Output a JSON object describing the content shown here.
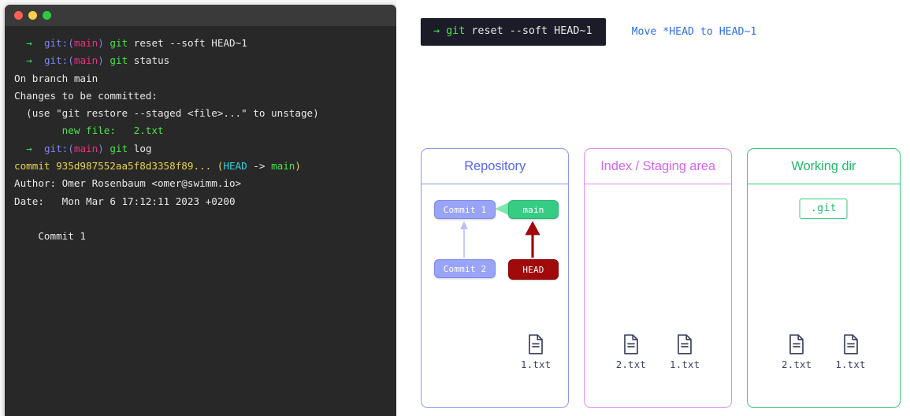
{
  "terminal": {
    "window_dots": [
      "close-red",
      "minimize-yellow",
      "maximize-green"
    ],
    "prompt_arrow": "→",
    "lines": [
      {
        "type": "prompt",
        "arrow": "→",
        "git": "git:",
        "lparen": "(",
        "branch": "main",
        "rparen": ")",
        "cmd": "git",
        "args": " reset --soft HEAD~1"
      },
      {
        "type": "prompt",
        "arrow": "→",
        "git": "git:",
        "lparen": "(",
        "branch": "main",
        "rparen": ")",
        "cmd": "git",
        "args": " status"
      },
      {
        "type": "plain",
        "text": "On branch main"
      },
      {
        "type": "plain",
        "text": "Changes to be committed:"
      },
      {
        "type": "plain",
        "text": "  (use \"git restore --staged <file>...\" to unstage)"
      },
      {
        "type": "green",
        "text": "        new file:   2.txt"
      },
      {
        "type": "prompt",
        "arrow": "→",
        "git": "git:",
        "lparen": "(",
        "branch": "main",
        "rparen": ")",
        "cmd": "git",
        "args": " log"
      },
      {
        "type": "commit",
        "label": "commit ",
        "hash": "935d987552aa5f8d3358f89... ",
        "lparen": "(",
        "head": "HEAD",
        "sep": " -> ",
        "branch": "main",
        "rparen": ")"
      },
      {
        "type": "plain",
        "text": "Author: Omer Rosenbaum <omer@swimm.io>"
      },
      {
        "type": "plain",
        "text": "Date:   Mon Mar 6 17:12:11 2023 +0200"
      },
      {
        "type": "plain",
        "text": ""
      },
      {
        "type": "plain",
        "text": "    Commit 1"
      }
    ]
  },
  "command_banner": {
    "arrow": "→",
    "cmd": "git",
    "args": " reset --soft HEAD~1",
    "note": "Move *HEAD to HEAD~1"
  },
  "panels": [
    {
      "id": "repository",
      "title": "Repository",
      "color": "#5566ef",
      "border": "#8b97f7",
      "nodes": [
        {
          "id": "commit1",
          "label": "Commit 1",
          "kind": "commit"
        },
        {
          "id": "commit2",
          "label": "Commit 2",
          "kind": "commit"
        },
        {
          "id": "main",
          "label": "main",
          "kind": "branch"
        },
        {
          "id": "head",
          "label": "HEAD",
          "kind": "head"
        }
      ],
      "arrows": [
        {
          "from": "commit2",
          "to": "commit1",
          "color": "#b9c0f9"
        },
        {
          "from": "main",
          "to": "commit1",
          "color": "#7ee8ae"
        },
        {
          "from": "head",
          "to": "main",
          "color": "#a00a0a"
        }
      ],
      "files": [
        {
          "name": "1.txt"
        }
      ]
    },
    {
      "id": "index",
      "title": "Index / Staging area",
      "color": "#d764f2",
      "border": "#e08ef5",
      "files": [
        {
          "name": "2.txt"
        },
        {
          "name": "1.txt"
        }
      ]
    },
    {
      "id": "working",
      "title": "Working dir",
      "color": "#1fbb6a",
      "border": "#2fcc7a",
      "git_box": ".git",
      "files": [
        {
          "name": "2.txt"
        },
        {
          "name": "1.txt"
        }
      ]
    }
  ]
}
